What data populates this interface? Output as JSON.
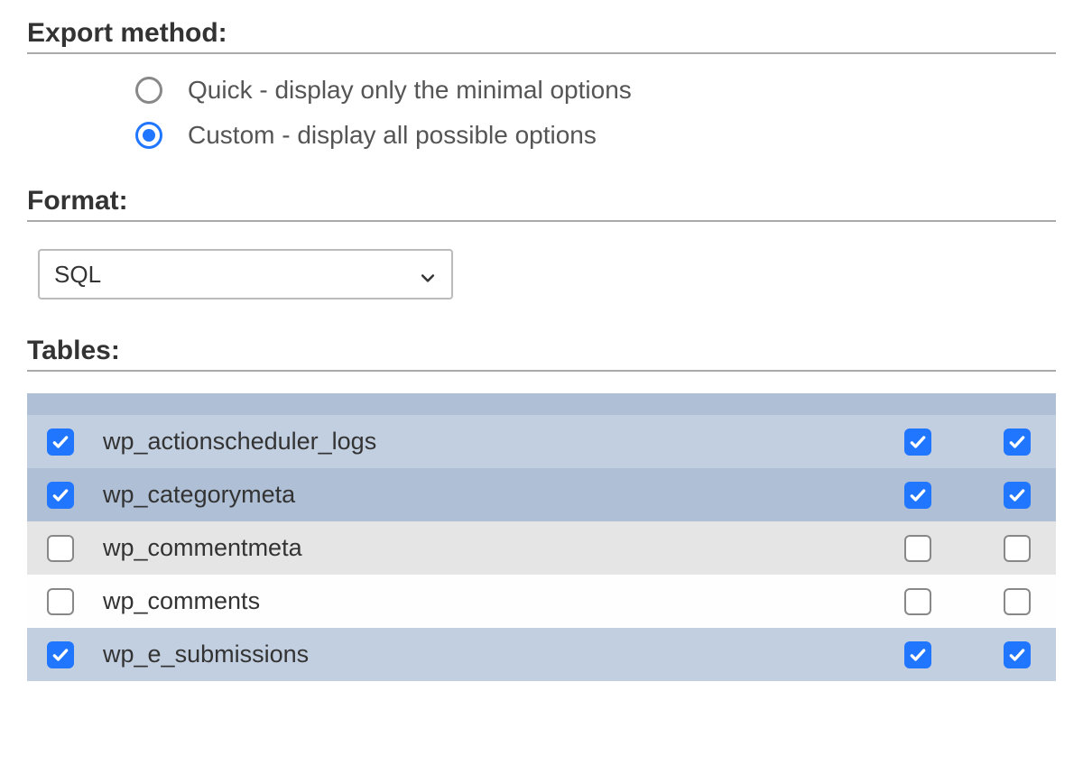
{
  "exportMethod": {
    "heading": "Export method:",
    "options": [
      {
        "label": "Quick - display only the minimal options",
        "selected": false
      },
      {
        "label": "Custom - display all possible options",
        "selected": true
      }
    ]
  },
  "format": {
    "heading": "Format:",
    "selected": "SQL"
  },
  "tables": {
    "heading": "Tables:",
    "rows": [
      {
        "name": "wp_actionscheduler_logs",
        "selected": true,
        "structure": true,
        "dataCol": true,
        "variant": "blue-light"
      },
      {
        "name": "wp_categorymeta",
        "selected": true,
        "structure": true,
        "dataCol": true,
        "variant": "blue-dark"
      },
      {
        "name": "wp_commentmeta",
        "selected": false,
        "structure": false,
        "dataCol": false,
        "variant": "grey"
      },
      {
        "name": "wp_comments",
        "selected": false,
        "structure": false,
        "dataCol": false,
        "variant": "white"
      },
      {
        "name": "wp_e_submissions",
        "selected": true,
        "structure": true,
        "dataCol": true,
        "variant": "blue-light"
      }
    ]
  }
}
